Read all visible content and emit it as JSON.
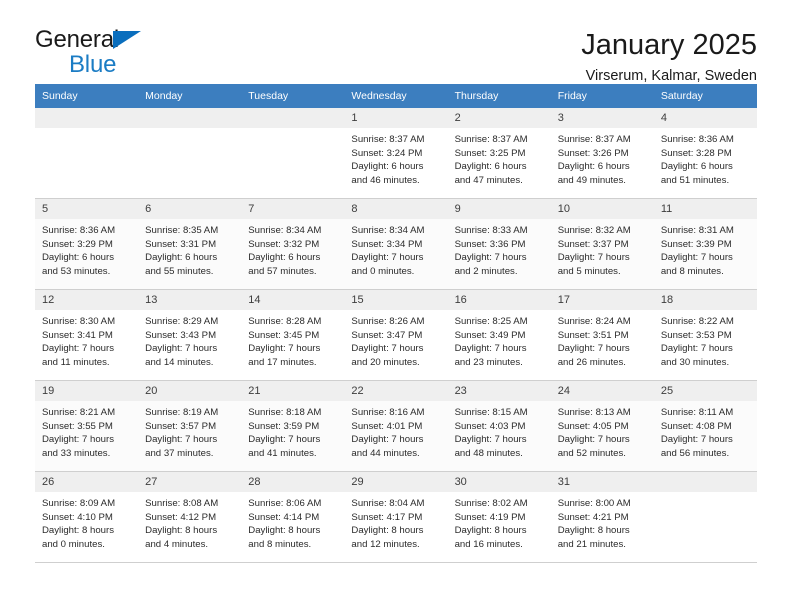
{
  "brand": {
    "line1": "General",
    "line2": "Blue",
    "triangle_color": "#0a6ebd",
    "text_color": "#1b7cc4"
  },
  "header": {
    "title": "January 2025",
    "subtitle": "Virserum, Kalmar, Sweden"
  },
  "theme": {
    "header_row_bg": "#3c7ebf",
    "header_row_text": "#ffffff",
    "daynum_bg": "#efefef",
    "grid_line": "#cfcfcf"
  },
  "weekdays": [
    "Sunday",
    "Monday",
    "Tuesday",
    "Wednesday",
    "Thursday",
    "Friday",
    "Saturday"
  ],
  "weeks": [
    [
      {
        "day": "",
        "l1": "",
        "l2": "",
        "l3": "",
        "l4": ""
      },
      {
        "day": "",
        "l1": "",
        "l2": "",
        "l3": "",
        "l4": ""
      },
      {
        "day": "",
        "l1": "",
        "l2": "",
        "l3": "",
        "l4": ""
      },
      {
        "day": "1",
        "l1": "Sunrise: 8:37 AM",
        "l2": "Sunset: 3:24 PM",
        "l3": "Daylight: 6 hours",
        "l4": "and 46 minutes."
      },
      {
        "day": "2",
        "l1": "Sunrise: 8:37 AM",
        "l2": "Sunset: 3:25 PM",
        "l3": "Daylight: 6 hours",
        "l4": "and 47 minutes."
      },
      {
        "day": "3",
        "l1": "Sunrise: 8:37 AM",
        "l2": "Sunset: 3:26 PM",
        "l3": "Daylight: 6 hours",
        "l4": "and 49 minutes."
      },
      {
        "day": "4",
        "l1": "Sunrise: 8:36 AM",
        "l2": "Sunset: 3:28 PM",
        "l3": "Daylight: 6 hours",
        "l4": "and 51 minutes."
      }
    ],
    [
      {
        "day": "5",
        "l1": "Sunrise: 8:36 AM",
        "l2": "Sunset: 3:29 PM",
        "l3": "Daylight: 6 hours",
        "l4": "and 53 minutes."
      },
      {
        "day": "6",
        "l1": "Sunrise: 8:35 AM",
        "l2": "Sunset: 3:31 PM",
        "l3": "Daylight: 6 hours",
        "l4": "and 55 minutes."
      },
      {
        "day": "7",
        "l1": "Sunrise: 8:34 AM",
        "l2": "Sunset: 3:32 PM",
        "l3": "Daylight: 6 hours",
        "l4": "and 57 minutes."
      },
      {
        "day": "8",
        "l1": "Sunrise: 8:34 AM",
        "l2": "Sunset: 3:34 PM",
        "l3": "Daylight: 7 hours",
        "l4": "and 0 minutes."
      },
      {
        "day": "9",
        "l1": "Sunrise: 8:33 AM",
        "l2": "Sunset: 3:36 PM",
        "l3": "Daylight: 7 hours",
        "l4": "and 2 minutes."
      },
      {
        "day": "10",
        "l1": "Sunrise: 8:32 AM",
        "l2": "Sunset: 3:37 PM",
        "l3": "Daylight: 7 hours",
        "l4": "and 5 minutes."
      },
      {
        "day": "11",
        "l1": "Sunrise: 8:31 AM",
        "l2": "Sunset: 3:39 PM",
        "l3": "Daylight: 7 hours",
        "l4": "and 8 minutes."
      }
    ],
    [
      {
        "day": "12",
        "l1": "Sunrise: 8:30 AM",
        "l2": "Sunset: 3:41 PM",
        "l3": "Daylight: 7 hours",
        "l4": "and 11 minutes."
      },
      {
        "day": "13",
        "l1": "Sunrise: 8:29 AM",
        "l2": "Sunset: 3:43 PM",
        "l3": "Daylight: 7 hours",
        "l4": "and 14 minutes."
      },
      {
        "day": "14",
        "l1": "Sunrise: 8:28 AM",
        "l2": "Sunset: 3:45 PM",
        "l3": "Daylight: 7 hours",
        "l4": "and 17 minutes."
      },
      {
        "day": "15",
        "l1": "Sunrise: 8:26 AM",
        "l2": "Sunset: 3:47 PM",
        "l3": "Daylight: 7 hours",
        "l4": "and 20 minutes."
      },
      {
        "day": "16",
        "l1": "Sunrise: 8:25 AM",
        "l2": "Sunset: 3:49 PM",
        "l3": "Daylight: 7 hours",
        "l4": "and 23 minutes."
      },
      {
        "day": "17",
        "l1": "Sunrise: 8:24 AM",
        "l2": "Sunset: 3:51 PM",
        "l3": "Daylight: 7 hours",
        "l4": "and 26 minutes."
      },
      {
        "day": "18",
        "l1": "Sunrise: 8:22 AM",
        "l2": "Sunset: 3:53 PM",
        "l3": "Daylight: 7 hours",
        "l4": "and 30 minutes."
      }
    ],
    [
      {
        "day": "19",
        "l1": "Sunrise: 8:21 AM",
        "l2": "Sunset: 3:55 PM",
        "l3": "Daylight: 7 hours",
        "l4": "and 33 minutes."
      },
      {
        "day": "20",
        "l1": "Sunrise: 8:19 AM",
        "l2": "Sunset: 3:57 PM",
        "l3": "Daylight: 7 hours",
        "l4": "and 37 minutes."
      },
      {
        "day": "21",
        "l1": "Sunrise: 8:18 AM",
        "l2": "Sunset: 3:59 PM",
        "l3": "Daylight: 7 hours",
        "l4": "and 41 minutes."
      },
      {
        "day": "22",
        "l1": "Sunrise: 8:16 AM",
        "l2": "Sunset: 4:01 PM",
        "l3": "Daylight: 7 hours",
        "l4": "and 44 minutes."
      },
      {
        "day": "23",
        "l1": "Sunrise: 8:15 AM",
        "l2": "Sunset: 4:03 PM",
        "l3": "Daylight: 7 hours",
        "l4": "and 48 minutes."
      },
      {
        "day": "24",
        "l1": "Sunrise: 8:13 AM",
        "l2": "Sunset: 4:05 PM",
        "l3": "Daylight: 7 hours",
        "l4": "and 52 minutes."
      },
      {
        "day": "25",
        "l1": "Sunrise: 8:11 AM",
        "l2": "Sunset: 4:08 PM",
        "l3": "Daylight: 7 hours",
        "l4": "and 56 minutes."
      }
    ],
    [
      {
        "day": "26",
        "l1": "Sunrise: 8:09 AM",
        "l2": "Sunset: 4:10 PM",
        "l3": "Daylight: 8 hours",
        "l4": "and 0 minutes."
      },
      {
        "day": "27",
        "l1": "Sunrise: 8:08 AM",
        "l2": "Sunset: 4:12 PM",
        "l3": "Daylight: 8 hours",
        "l4": "and 4 minutes."
      },
      {
        "day": "28",
        "l1": "Sunrise: 8:06 AM",
        "l2": "Sunset: 4:14 PM",
        "l3": "Daylight: 8 hours",
        "l4": "and 8 minutes."
      },
      {
        "day": "29",
        "l1": "Sunrise: 8:04 AM",
        "l2": "Sunset: 4:17 PM",
        "l3": "Daylight: 8 hours",
        "l4": "and 12 minutes."
      },
      {
        "day": "30",
        "l1": "Sunrise: 8:02 AM",
        "l2": "Sunset: 4:19 PM",
        "l3": "Daylight: 8 hours",
        "l4": "and 16 minutes."
      },
      {
        "day": "31",
        "l1": "Sunrise: 8:00 AM",
        "l2": "Sunset: 4:21 PM",
        "l3": "Daylight: 8 hours",
        "l4": "and 21 minutes."
      },
      {
        "day": "",
        "l1": "",
        "l2": "",
        "l3": "",
        "l4": ""
      }
    ]
  ]
}
